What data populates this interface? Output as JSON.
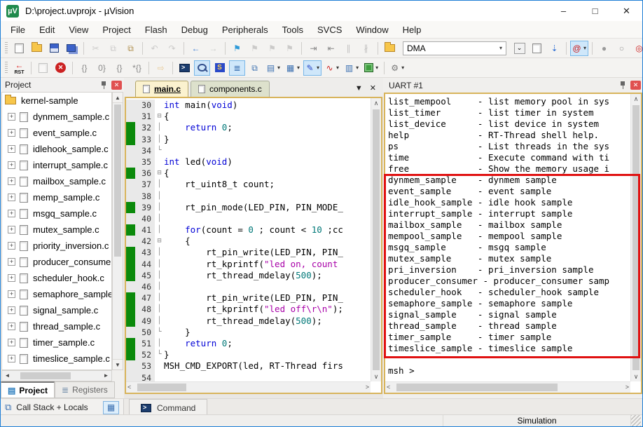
{
  "window": {
    "title": "D:\\project.uvprojx - µVision",
    "minimize": "–",
    "maximize": "□",
    "close": "✕"
  },
  "menu": [
    "File",
    "Edit",
    "View",
    "Project",
    "Flash",
    "Debug",
    "Peripherals",
    "Tools",
    "SVCS",
    "Window",
    "Help"
  ],
  "toolbar1": [
    {
      "name": "new-file-button",
      "cls": "g-page"
    },
    {
      "name": "open-file-button",
      "cls": "g-folder"
    },
    {
      "name": "save-button",
      "cls": "g-floppy"
    },
    {
      "name": "save-all-button",
      "cls": "g-floppy2"
    },
    {
      "sep": true
    },
    {
      "name": "cut-button",
      "glyph": "✂",
      "fg": "#9a9a9a",
      "dis": true
    },
    {
      "name": "copy-button",
      "glyph": "⧉",
      "fg": "#9a9a9a",
      "dis": true
    },
    {
      "name": "paste-button",
      "glyph": "⧉",
      "fg": "#b08f4e"
    },
    {
      "sep": true
    },
    {
      "name": "undo-button",
      "glyph": "↶",
      "fg": "#9a9a9a",
      "dis": true
    },
    {
      "name": "redo-button",
      "glyph": "↷",
      "fg": "#9a9a9a",
      "dis": true
    },
    {
      "sep": true
    },
    {
      "name": "navigate-back-button",
      "glyph": "←",
      "fg": "#3f7fd4"
    },
    {
      "name": "navigate-forward-button",
      "glyph": "→",
      "fg": "#9a9a9a",
      "dis": true
    },
    {
      "sep": true
    },
    {
      "name": "toggle-bookmark-button",
      "glyph": "⚑",
      "fg": "#2e9ad8"
    },
    {
      "name": "prev-bookmark-button",
      "glyph": "⚑",
      "fg": "#9a9a9a",
      "dis": true
    },
    {
      "name": "next-bookmark-button",
      "glyph": "⚑",
      "fg": "#9a9a9a",
      "dis": true
    },
    {
      "name": "clear-bookmarks-button",
      "glyph": "⚑",
      "fg": "#9a9a9a",
      "dis": true
    },
    {
      "sep": true
    },
    {
      "name": "indent-button",
      "glyph": "⇥",
      "fg": "#8a8a8a"
    },
    {
      "name": "outdent-button",
      "glyph": "⇤",
      "fg": "#8a8a8a"
    },
    {
      "name": "comment-button",
      "glyph": "∥",
      "fg": "#8a8a8a",
      "dis": true
    },
    {
      "name": "uncomment-button",
      "glyph": "∦",
      "fg": "#8a8a8a",
      "dis": true
    },
    {
      "sep": true
    },
    {
      "name": "find-in-files-button",
      "cls": "g-folder"
    },
    {
      "combo": true,
      "name": "find-combobox",
      "value": "DMA"
    },
    {
      "name": "combo-dropdown-button",
      "glyph": "⌄",
      "cls": "g-box"
    },
    {
      "name": "find-next-button",
      "cls": "g-page"
    },
    {
      "name": "incremental-find-button",
      "glyph": "⇣",
      "fg": "#2e6fd4"
    },
    {
      "sep": true
    },
    {
      "name": "quick-find-button",
      "glyph": "@",
      "fg": "#cc1111",
      "dd": true,
      "active": true
    },
    {
      "sep": true
    },
    {
      "name": "insert-breakpoint-button",
      "glyph": "●",
      "fg": "#9a9a9a"
    },
    {
      "name": "enable-breakpoint-button",
      "glyph": "○",
      "fg": "#9a9a9a"
    },
    {
      "name": "disable-all-breakpoints-button",
      "glyph": "◎",
      "fg": "#cc2222"
    },
    {
      "name": "kill-all-breakpoints-button",
      "glyph": "⊗",
      "fg": "#cc2222"
    },
    {
      "sep": true
    },
    {
      "name": "configure-window-button",
      "cls": "g-win",
      "active": true
    }
  ],
  "toolbar2": [
    {
      "name": "reset-cpu-button",
      "glyph": "←",
      "fg": "#d22",
      "col": true,
      "label": "RST"
    },
    {
      "sep": true
    },
    {
      "name": "show-next-statement-button",
      "cls": "g-page",
      "dis": true
    },
    {
      "name": "stop-debug-button",
      "glyph": "✕",
      "cls": "g-redcircle"
    },
    {
      "sep": true
    },
    {
      "name": "step-into-button",
      "glyph": "{}",
      "fg": "#8a8a8a"
    },
    {
      "name": "step-over-button",
      "glyph": "0}",
      "fg": "#8a8a8a"
    },
    {
      "name": "step-out-button",
      "glyph": "{}",
      "fg": "#8a8a8a"
    },
    {
      "name": "run-to-line-button",
      "glyph": "*{}",
      "fg": "#8a8a8a"
    },
    {
      "sep": true
    },
    {
      "name": "run-button",
      "glyph": "⇨",
      "fg": "#d89a2a",
      "dis": true
    },
    {
      "sep": true
    },
    {
      "name": "command-window-button",
      "glyph": ">",
      "cls": "g-term"
    },
    {
      "name": "disassembly-window-button",
      "cls": "g-mag",
      "active": true
    },
    {
      "name": "symbol-window-button",
      "glyph": "S",
      "cls": "g-sym"
    },
    {
      "name": "registers-window-button",
      "glyph": "≣",
      "fg": "#3a6fb0",
      "active": true
    },
    {
      "name": "call-stack-window-button",
      "glyph": "⧉",
      "fg": "#3a6fb0"
    },
    {
      "name": "watch-window-button",
      "glyph": "▤",
      "fg": "#3a6fb0",
      "dd": true
    },
    {
      "name": "memory-window-button",
      "glyph": "▦",
      "fg": "#3a6fb0",
      "dd": true
    },
    {
      "name": "serial-window-button",
      "glyph": "✎",
      "fg": "#2a49c8",
      "active": true,
      "dd": true
    },
    {
      "name": "logic-analyzer-button",
      "glyph": "∿",
      "fg": "#cc2222",
      "dd": true
    },
    {
      "name": "system-viewer-button",
      "glyph": "▥",
      "fg": "#3a6fb0",
      "dd": true
    },
    {
      "name": "peripherals-button",
      "cls": "g-chip",
      "dd": true
    },
    {
      "sep": true
    },
    {
      "name": "toolbox-button",
      "glyph": "⚙",
      "fg": "#777777",
      "dd": true
    }
  ],
  "project_panel": {
    "title": "Project",
    "root": "kernel-sample",
    "files": [
      "dynmem_sample.c",
      "event_sample.c",
      "idlehook_sample.c",
      "interrupt_sample.c",
      "mailbox_sample.c",
      "memp_sample.c",
      "msgq_sample.c",
      "mutex_sample.c",
      "priority_inversion.c",
      "producer_consumer",
      "scheduler_hook.c",
      "semaphore_sample.",
      "signal_sample.c",
      "thread_sample.c",
      "timer_sample.c",
      "timeslice_sample.c"
    ],
    "tabs": [
      "Project",
      "Registers"
    ]
  },
  "editor": {
    "tabs": [
      "main.c",
      "components.c"
    ],
    "command_tab": "Command",
    "code": [
      {
        "n": 30,
        "s": [
          [
            "k",
            "int"
          ],
          [
            "p",
            " main("
          ],
          [
            "k",
            "void"
          ],
          [
            "p",
            ")"
          ]
        ]
      },
      {
        "n": 31,
        "f": "⊟",
        "s": [
          [
            "p",
            "{"
          ]
        ]
      },
      {
        "n": 32,
        "g": 1,
        "f": "│",
        "s": [
          [
            "p",
            "    "
          ],
          [
            "k",
            "return"
          ],
          [
            "p",
            " "
          ],
          [
            "num",
            "0"
          ],
          [
            "p",
            ";"
          ]
        ]
      },
      {
        "n": 33,
        "g": 1,
        "f": "│",
        "s": [
          [
            "p",
            "}"
          ]
        ]
      },
      {
        "n": 34,
        "f": "└",
        "s": []
      },
      {
        "n": 35,
        "s": [
          [
            "k",
            "int"
          ],
          [
            "p",
            " led("
          ],
          [
            "k",
            "void"
          ],
          [
            "p",
            ")"
          ]
        ]
      },
      {
        "n": 36,
        "g": 1,
        "f": "⊟",
        "s": [
          [
            "p",
            "{"
          ]
        ]
      },
      {
        "n": 37,
        "f": "│",
        "s": [
          [
            "p",
            "    rt_uint8_t count;"
          ]
        ]
      },
      {
        "n": 38,
        "f": "│",
        "s": []
      },
      {
        "n": 39,
        "g": 1,
        "f": "│",
        "s": [
          [
            "p",
            "    rt_pin_mode(LED_PIN, PIN_MODE_"
          ]
        ]
      },
      {
        "n": 40,
        "f": "│",
        "s": []
      },
      {
        "n": 41,
        "g": 1,
        "f": "│",
        "s": [
          [
            "p",
            "    "
          ],
          [
            "k",
            "for"
          ],
          [
            "p",
            "(count = "
          ],
          [
            "num",
            "0"
          ],
          [
            "p",
            " ; count < "
          ],
          [
            "num",
            "10"
          ],
          [
            "p",
            " ;cc"
          ]
        ]
      },
      {
        "n": 42,
        "f": "⊟",
        "s": [
          [
            "p",
            "    {"
          ]
        ]
      },
      {
        "n": 43,
        "g": 1,
        "f": "│",
        "s": [
          [
            "p",
            "        rt_pin_write(LED_PIN, PIN_"
          ]
        ]
      },
      {
        "n": 44,
        "g": 1,
        "f": "│",
        "s": [
          [
            "p",
            "        rt_kprintf("
          ],
          [
            "str",
            "\"led on, count"
          ]
        ]
      },
      {
        "n": 45,
        "g": 1,
        "f": "│",
        "s": [
          [
            "p",
            "        rt_thread_mdelay("
          ],
          [
            "num",
            "500"
          ],
          [
            "p",
            ");"
          ]
        ]
      },
      {
        "n": 46,
        "f": "│",
        "s": []
      },
      {
        "n": 47,
        "g": 1,
        "f": "│",
        "s": [
          [
            "p",
            "        rt_pin_write(LED_PIN, PIN_"
          ]
        ]
      },
      {
        "n": 48,
        "g": 1,
        "f": "│",
        "s": [
          [
            "p",
            "        rt_kprintf("
          ],
          [
            "str",
            "\"led off\\r\\n\""
          ],
          [
            "p",
            ");"
          ]
        ]
      },
      {
        "n": 49,
        "g": 1,
        "f": "│",
        "s": [
          [
            "p",
            "        rt_thread_mdelay("
          ],
          [
            "num",
            "500"
          ],
          [
            "p",
            ");"
          ]
        ]
      },
      {
        "n": 50,
        "f": "└",
        "s": [
          [
            "p",
            "    }"
          ]
        ]
      },
      {
        "n": 51,
        "g": 1,
        "f": "│",
        "s": [
          [
            "p",
            "    "
          ],
          [
            "k",
            "return"
          ],
          [
            "p",
            " "
          ],
          [
            "num",
            "0"
          ],
          [
            "p",
            ";"
          ]
        ]
      },
      {
        "n": 52,
        "g": 1,
        "f": "└",
        "s": [
          [
            "p",
            "}"
          ]
        ]
      },
      {
        "n": 53,
        "s": [
          [
            "p",
            "MSH_CMD_EXPORT(led, RT-Thread firs"
          ]
        ]
      },
      {
        "n": 54,
        "s": []
      }
    ]
  },
  "uart": {
    "title": "UART #1",
    "lines": [
      "list_mempool     - list memory pool in sys",
      "list_timer       - list timer in system",
      "list_device      - list device in system",
      "help             - RT-Thread shell help.",
      "ps               - List threads in the sys",
      "time             - Execute command with ti",
      "free             - Show the memory usage i",
      "dynmem_sample    - dynmem sample",
      "event_sample     - event sample",
      "idle_hook_sample - idle hook sample",
      "interrupt_sample - interrupt sample",
      "mailbox_sample   - mailbox sample",
      "mempool_sample   - mempool sample",
      "msgq_sample      - msgq sample",
      "mutex_sample     - mutex sample",
      "pri_inversion    - pri_inversion sample",
      "producer_consumer - producer_consumer samp",
      "scheduler_hook   - scheduler_hook sample",
      "semaphore_sample - semaphore sample",
      "signal_sample    - signal sample",
      "thread_sample    - thread sample",
      "timer_sample     - timer sample",
      "timeslice_sample - timeslice sample",
      "",
      "msh >"
    ]
  },
  "bottom": {
    "call_stack_label": "Call Stack + Locals"
  },
  "statusbar": {
    "mode": "Simulation"
  },
  "colors": {
    "coverage_green": "#0b8a0b",
    "annotation_red": "#e01111",
    "keyword_blue": "#0202d6",
    "number_teal": "#007878",
    "string_purple": "#a800a8",
    "frame_gold": "#d8b45c"
  }
}
